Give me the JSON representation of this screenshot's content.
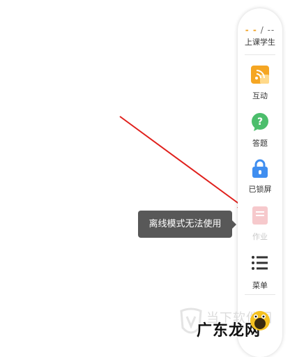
{
  "panel": {
    "count_dashes": "- -",
    "count_rest": "/ --",
    "students_label": "上课学生",
    "tools": [
      {
        "label": "互动",
        "icon": "interaction-icon",
        "color": "#f5a623",
        "enabled": true
      },
      {
        "label": "答题",
        "icon": "question-icon",
        "color": "#4cbe6c",
        "enabled": true
      },
      {
        "label": "已锁屏",
        "icon": "lock-icon",
        "color": "#3f8ef0",
        "enabled": true
      },
      {
        "label": "作业",
        "icon": "homework-icon",
        "color": "#f6c9cc",
        "enabled": false
      },
      {
        "label": "菜单",
        "icon": "menu-icon",
        "color": "#333333",
        "enabled": true
      }
    ]
  },
  "tooltip": {
    "text": "离线模式无法使用"
  },
  "annotation": {
    "color": "#e0201c"
  },
  "watermark": {
    "faint_text": "当下软件园",
    "bold_text": "广东龙网"
  }
}
